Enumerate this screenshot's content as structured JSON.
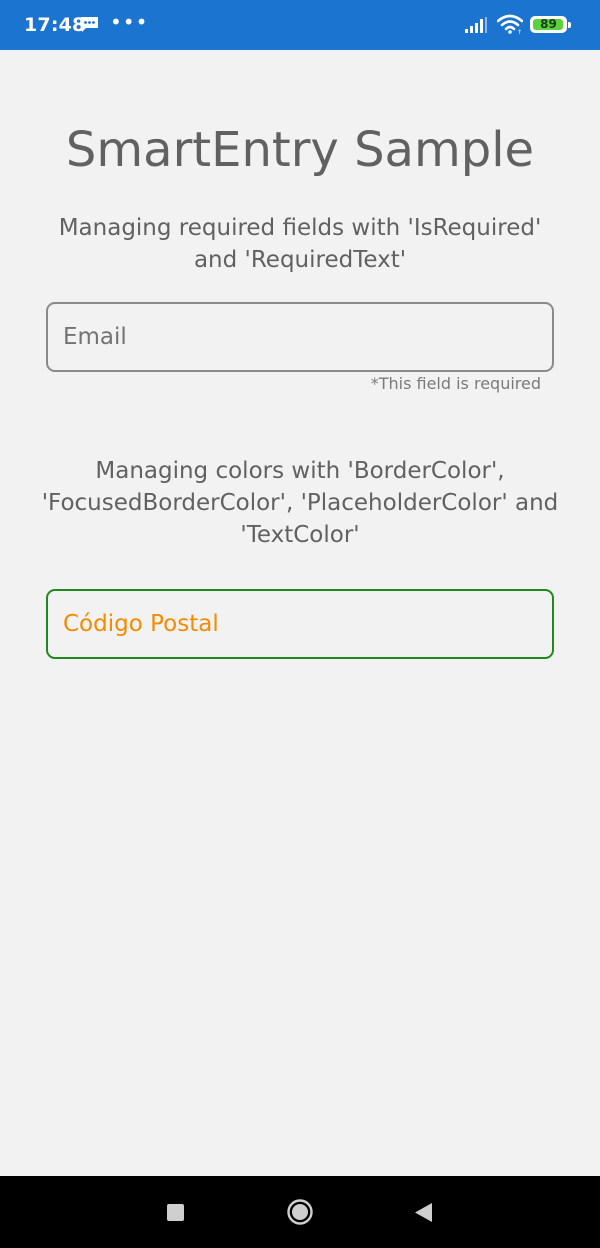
{
  "status_bar": {
    "time": "17:48",
    "battery_level": "89",
    "more_glyph": "•••",
    "icons": [
      "message-icon",
      "more-icon",
      "signal-icon",
      "wifi-icon",
      "battery-icon"
    ],
    "background_color": "#1b74d0"
  },
  "page": {
    "title": "SmartEntry Sample",
    "required_section": {
      "description": "Managing required fields with 'IsRequired' and 'RequiredText'",
      "email_placeholder": "Email",
      "email_value": "",
      "required_text": "*This field is required"
    },
    "colors_section": {
      "description": "Managing colors with 'BorderColor', 'FocusedBorderColor', 'PlaceholderColor' and 'TextColor'",
      "postal_placeholder": "Código Postal",
      "postal_value": "",
      "border_color": "#1e8a1e",
      "placeholder_color": "#f28c00"
    }
  },
  "nav_bar": {
    "buttons": [
      "recents-button",
      "home-button",
      "back-button"
    ]
  }
}
